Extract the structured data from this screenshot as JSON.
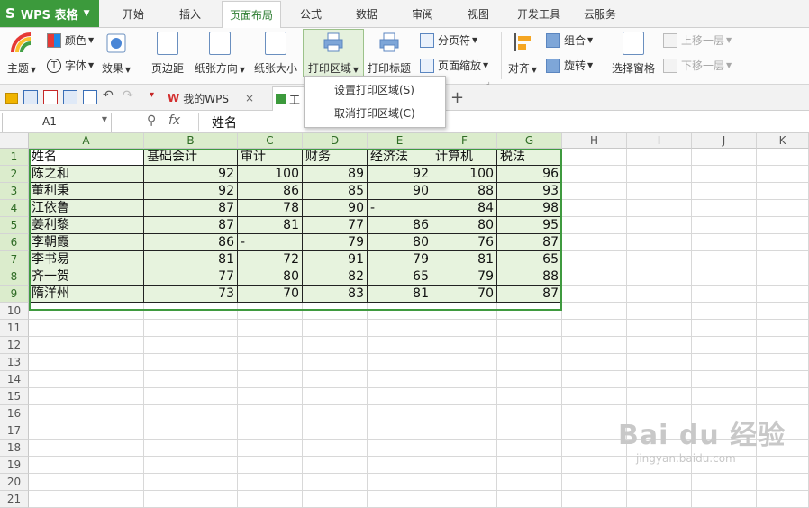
{
  "app": {
    "logo": "S",
    "name": "WPS 表格",
    "accent": "#3c9a3c"
  },
  "menu_tabs": [
    {
      "label": "开始"
    },
    {
      "label": "插入"
    },
    {
      "label": "页面布局",
      "active": true
    },
    {
      "label": "公式"
    },
    {
      "label": "数据"
    },
    {
      "label": "审阅"
    },
    {
      "label": "视图"
    },
    {
      "label": "开发工具"
    },
    {
      "label": "云服务"
    }
  ],
  "ribbon": {
    "theme": "主题",
    "color": "颜色",
    "font": "字体",
    "effect": "效果",
    "margin": "页边距",
    "orientation": "纸张方向",
    "size": "纸张大小",
    "print_area": "打印区域",
    "print_titles": "打印标题",
    "page_break": "分页符",
    "page_zoom": "页面缩放",
    "align": "对齐",
    "group": "组合",
    "rotate": "旋转",
    "selection_pane": "选择窗格",
    "bring_forward": "上移一层",
    "send_backward": "下移一层"
  },
  "dropdown": {
    "set": "设置打印区域(S)",
    "cancel": "取消打印区域(C)"
  },
  "doc_tabs": {
    "wps": "我的WPS",
    "workbook": "工",
    "close": "×",
    "add": "+"
  },
  "formula_bar": {
    "cell_ref": "A1",
    "fx": "fx",
    "content": "姓名"
  },
  "columns": [
    "A",
    "B",
    "C",
    "D",
    "E",
    "F",
    "G",
    "H",
    "I",
    "J",
    "K"
  ],
  "rows": [
    "1",
    "2",
    "3",
    "4",
    "5",
    "6",
    "7",
    "8",
    "9",
    "10",
    "11",
    "12",
    "13",
    "14",
    "15",
    "16",
    "17",
    "18",
    "19",
    "20",
    "21"
  ],
  "table": {
    "header": [
      "姓名",
      "基础会计",
      "审计",
      "财务",
      "经济法",
      "计算机",
      "税法"
    ],
    "data": [
      [
        "陈之和",
        "92",
        "100",
        "89",
        "92",
        "100",
        "96"
      ],
      [
        "董利秉",
        "92",
        "86",
        "85",
        "90",
        "88",
        "93"
      ],
      [
        "江依鲁",
        "87",
        "78",
        "90",
        "-",
        "84",
        "98"
      ],
      [
        "姜利黎",
        "87",
        "81",
        "77",
        "86",
        "80",
        "95"
      ],
      [
        "李朝霞",
        "86",
        "-",
        "79",
        "80",
        "76",
        "87"
      ],
      [
        "李书易",
        "81",
        "72",
        "91",
        "79",
        "81",
        "65"
      ],
      [
        "齐一贺",
        "77",
        "80",
        "82",
        "65",
        "79",
        "88"
      ],
      [
        "隋洋州",
        "73",
        "70",
        "83",
        "81",
        "70",
        "87"
      ]
    ]
  },
  "watermark": {
    "brand": "Bai du 经验",
    "url": "jingyan.baidu.com"
  }
}
